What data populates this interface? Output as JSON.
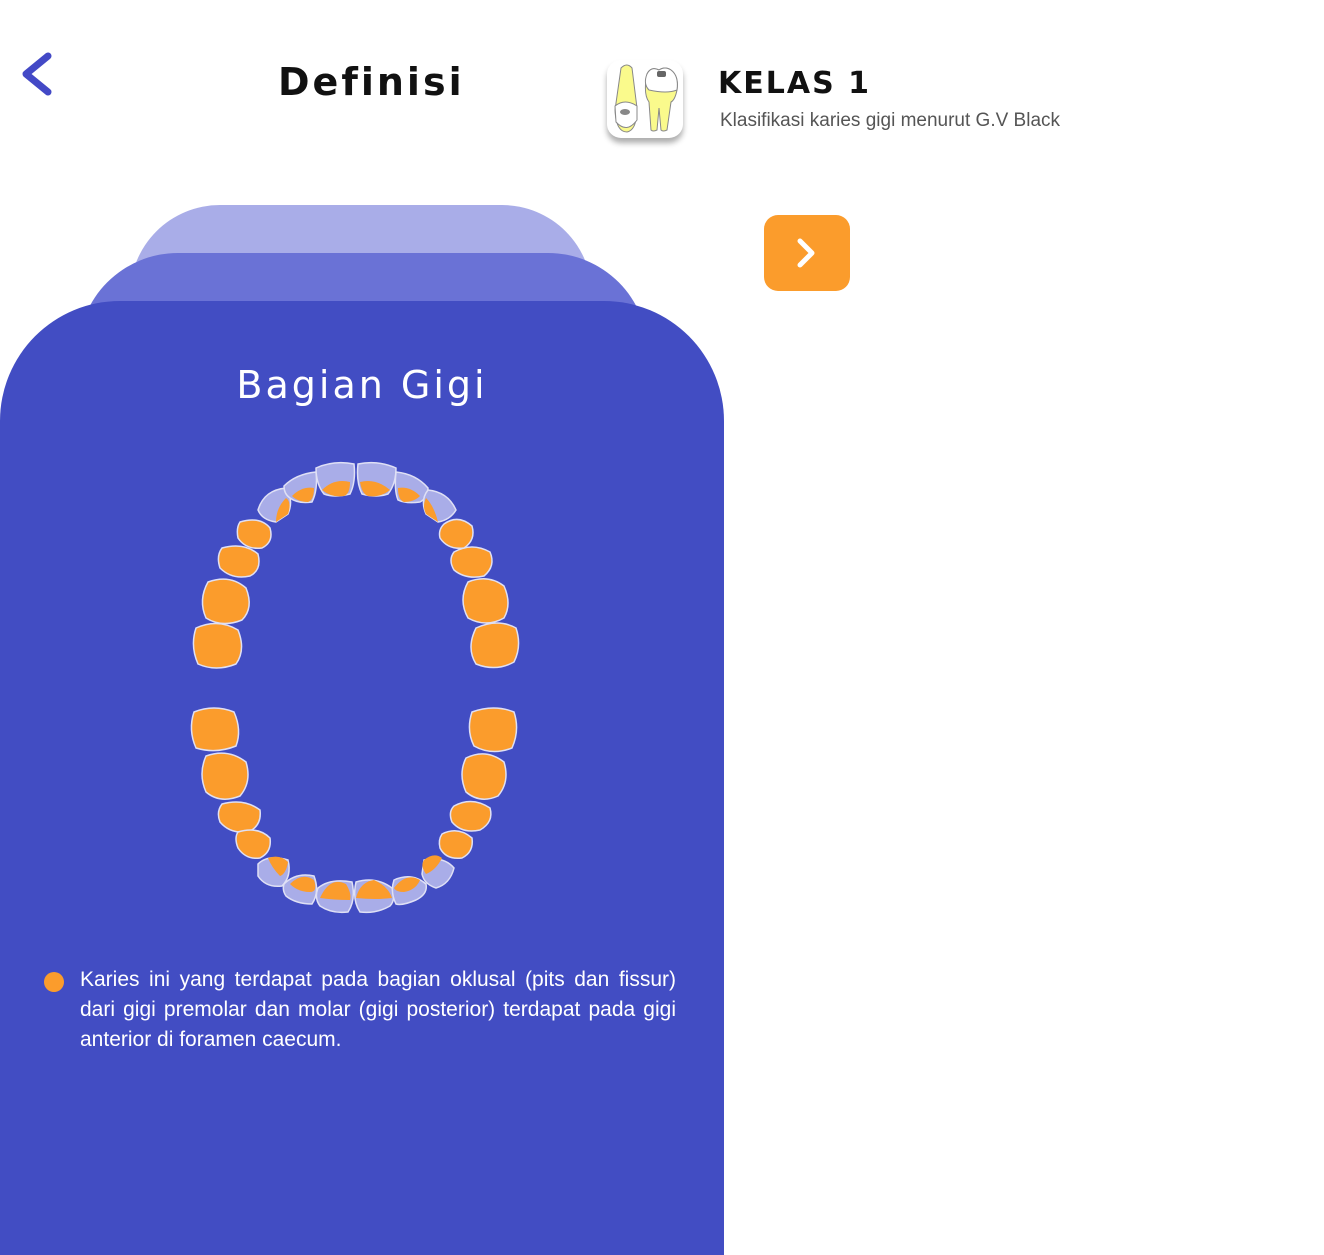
{
  "header": {
    "title": "Definisi",
    "back_icon": "chevron-left-icon",
    "app_icon": "tooth-cavity-icon",
    "class_title": "KELAS 1",
    "class_subtitle": "Klasifikasi karies gigi menurut G.V Black"
  },
  "next_button": {
    "icon": "chevron-right-icon"
  },
  "card": {
    "title": "Bagian Gigi",
    "diagram": "dental-arch-occlusal-view",
    "description": "Karies ini yang terdapat pada bagian oklusal (pits dan fissur) dari gigi premolar dan molar (gigi posterior) terdapat pada gigi anterior  di foramen caecum."
  },
  "colors": {
    "accent_orange": "#fb9c2c",
    "card_blue": "#424dc3",
    "card_mid": "#6a72d6",
    "card_light": "#a9ade8",
    "back_icon": "#4349c6"
  }
}
